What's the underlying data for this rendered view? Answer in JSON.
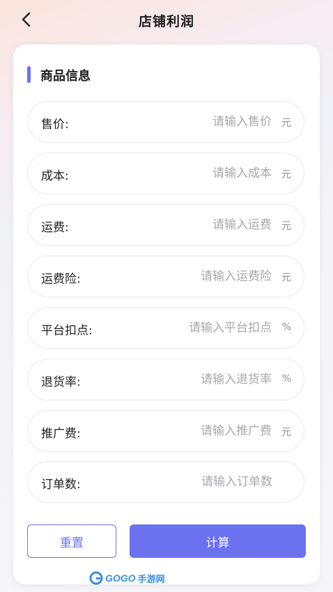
{
  "header": {
    "title": "店铺利润"
  },
  "section": {
    "title": "商品信息"
  },
  "fields": [
    {
      "label": "售价:",
      "placeholder": "请输入售价",
      "unit": "元",
      "value": ""
    },
    {
      "label": "成本:",
      "placeholder": "请输入成本",
      "unit": "元",
      "value": ""
    },
    {
      "label": "运费:",
      "placeholder": "请输入运费",
      "unit": "元",
      "value": ""
    },
    {
      "label": "运费险:",
      "placeholder": "请输入运费险",
      "unit": "元",
      "value": ""
    },
    {
      "label": "平台扣点:",
      "placeholder": "请输入平台扣点",
      "unit": "%",
      "value": ""
    },
    {
      "label": "退货率:",
      "placeholder": "请输入退货率",
      "unit": "%",
      "value": ""
    },
    {
      "label": "推广费:",
      "placeholder": "请输入推广费",
      "unit": "元",
      "value": ""
    },
    {
      "label": "订单数:",
      "placeholder": "请输入订单数",
      "unit": "",
      "value": ""
    }
  ],
  "buttons": {
    "reset": "重置",
    "calculate": "计算"
  },
  "watermark": {
    "brand": "GOGO",
    "suffix": "手游网"
  },
  "colors": {
    "accent": "#6b72f0"
  },
  "icons": {
    "back": "chevron-left-icon",
    "logo": "gogo-logo-icon"
  }
}
